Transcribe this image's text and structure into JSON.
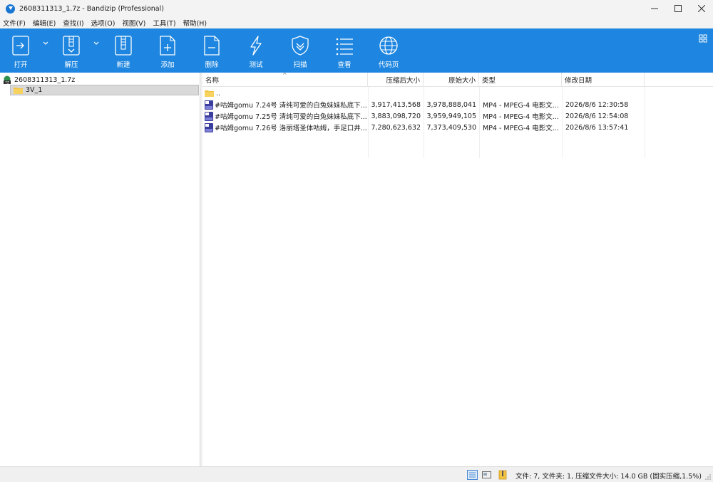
{
  "window": {
    "title": "2608311313_1.7z - Bandizip (Professional)",
    "minimize": "—",
    "maximize": "☐",
    "close": "✕"
  },
  "menu": [
    "文件(F)",
    "编辑(E)",
    "查找(I)",
    "选项(O)",
    "视图(V)",
    "工具(T)",
    "帮助(H)"
  ],
  "toolbar": {
    "open": "打开",
    "extract": "解压",
    "new": "新建",
    "add": "添加",
    "delete": "删除",
    "test": "测试",
    "scan": "扫描",
    "view": "查看",
    "codepage": "代码页"
  },
  "tree": {
    "root": "2608311313_1.7z",
    "child": "3V_1"
  },
  "columns": {
    "name": "名称",
    "compressed": "压缩后大小",
    "original": "原始大小",
    "type": "类型",
    "modified": "修改日期"
  },
  "rows": [
    {
      "name": "..",
      "compressed": "",
      "original": "",
      "type": "",
      "modified": "",
      "icon": "folder-icon"
    },
    {
      "name": "#咕姆gomu 7.24号 清纯可爱的白兔妹妹私底下...",
      "compressed": "3,917,413,568",
      "original": "3,978,888,041",
      "type": "MP4 - MPEG-4 电影文...",
      "modified": "2026/8/6 12:30:58",
      "icon": "video-file-icon"
    },
    {
      "name": "#咕姆gomu 7.25号 清纯可爱的白兔妹妹私底下...",
      "compressed": "3,883,098,720",
      "original": "3,959,949,105",
      "type": "MP4 - MPEG-4 电影文...",
      "modified": "2026/8/6 12:54:08",
      "icon": "video-file-icon"
    },
    {
      "name": "#咕姆gomu 7.26号 洛丽塔圣体咕姆，手足口井...",
      "compressed": "7,280,623,632",
      "original": "7,373,409,530",
      "type": "MP4 - MPEG-4 电影文...",
      "modified": "2026/8/6 13:57:41",
      "icon": "video-file-icon"
    }
  ],
  "status": {
    "text": "文件: 7, 文件夹: 1, 压缩文件大小: 14.0 GB (固实压缩,1.5%)"
  },
  "colors": {
    "toolbar": "#1e86e0",
    "selection": "#d9d9d9"
  }
}
